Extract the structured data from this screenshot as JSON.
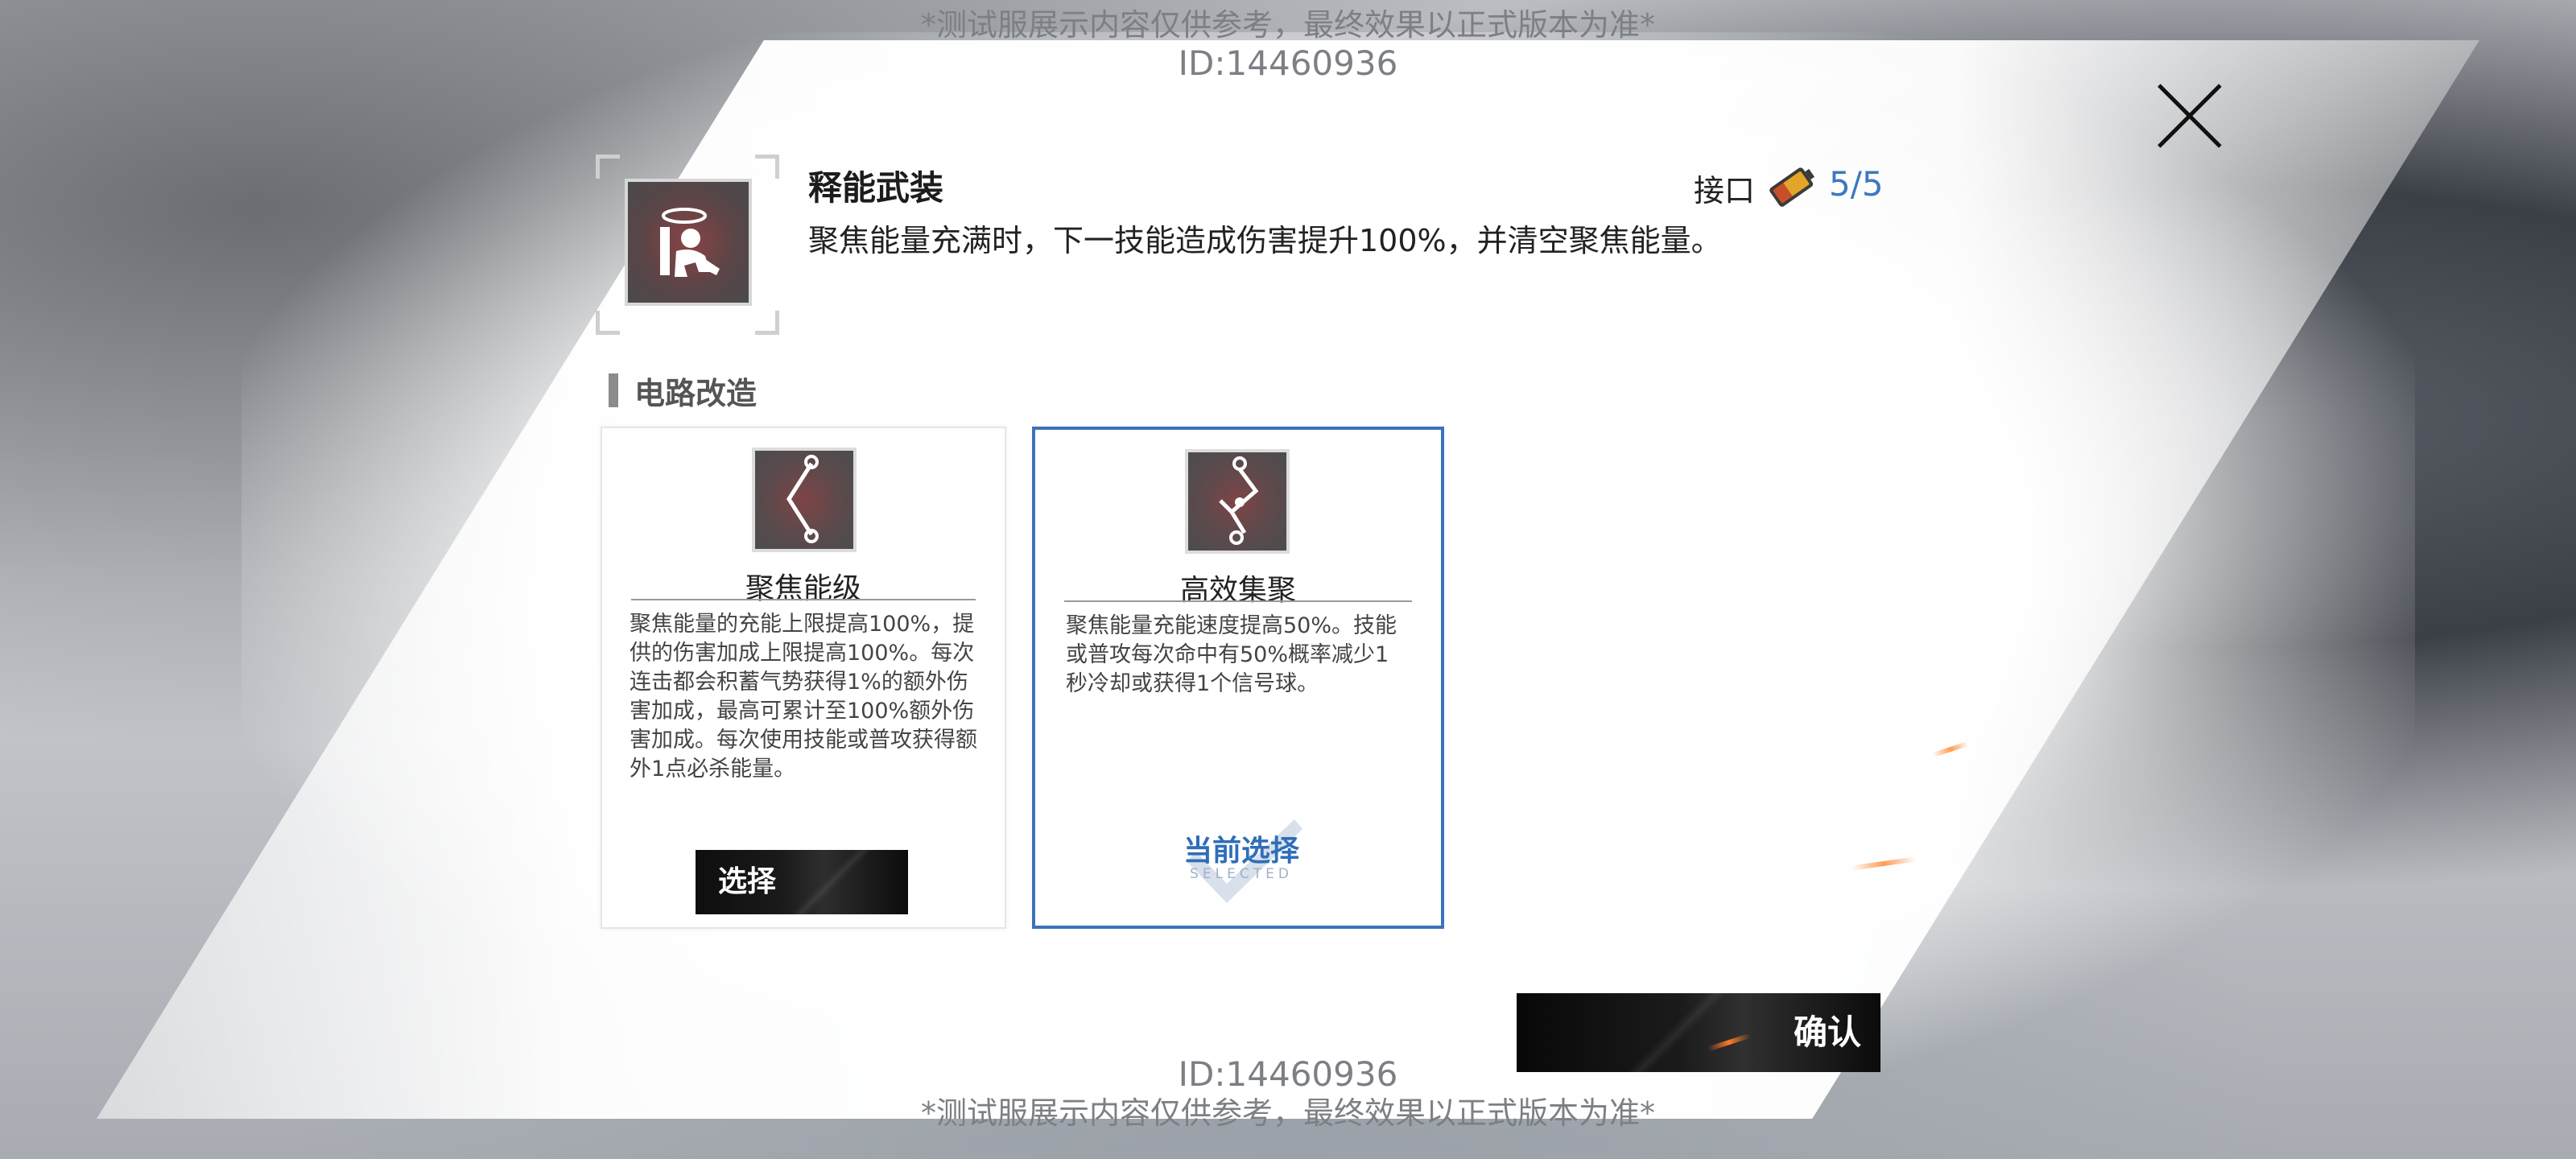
{
  "watermark": {
    "notice": "*测试服展示内容仅供参考，最终效果以正式版本为准*",
    "id": "ID:14460936"
  },
  "skill": {
    "title": "释能武装",
    "description": "聚焦能量充满时，下一技能造成伤害提升100%，并清空聚焦能量。",
    "port_label": "接口",
    "port_count": "5/5",
    "icon": "kneeling-figure-halo-icon"
  },
  "section": {
    "title": "电路改造"
  },
  "cards": [
    {
      "name": "聚焦能级",
      "description": "聚焦能量的充能上限提高100%，提供的伤害加成上限提高100%。每次连击都会积蓄气势获得1%的额外伤害加成，最高可累计至100%额外伤害加成。每次使用技能或普攻获得额外1点必杀能量。",
      "button_label": "选择",
      "icon": "circuit-chevron-icon",
      "selected": false
    },
    {
      "name": "高效集聚",
      "description": "聚焦能量充能速度提高50%。技能或普攻每次命中有50%概率减少1秒冷却或获得1个信号球。",
      "selected_label": "当前选择",
      "selected_sublabel": "SELECTED",
      "icon": "circuit-zigzag-icon",
      "selected": true
    }
  ],
  "confirm_label": "确认",
  "colors": {
    "accent_blue": "#3a73b9",
    "selected_text": "#2f6eb8",
    "button_dark": "#111111"
  }
}
